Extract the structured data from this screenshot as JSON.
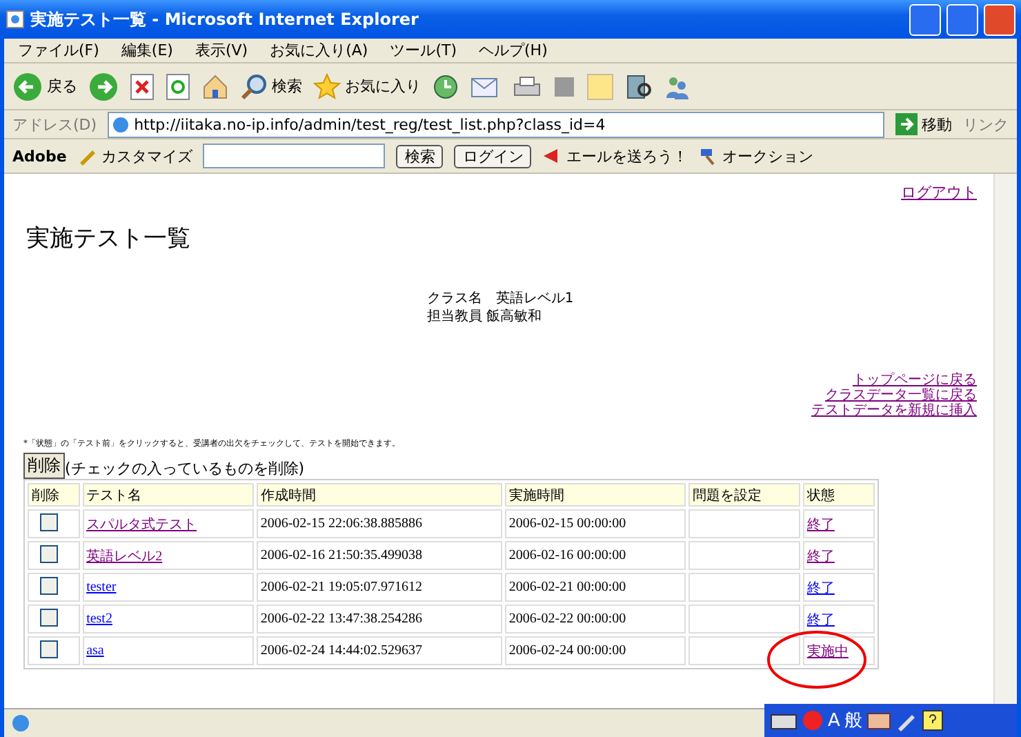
{
  "window": {
    "title": "実施テスト一覧 - Microsoft Internet Explorer"
  },
  "menu": [
    "ファイル(F)",
    "編集(E)",
    "表示(V)",
    "お気に入り(A)",
    "ツール(T)",
    "ヘルプ(H)"
  ],
  "toolbar": {
    "back": "戻る",
    "search": "検索",
    "favorites": "お気に入り"
  },
  "address": {
    "label": "アドレス(D)",
    "url": "http://iitaka.no-ip.info/admin/test_reg/test_list.php?class_id=4",
    "go": "移動",
    "links": "リンク"
  },
  "yahoo_bar": {
    "adobe": "Adobe",
    "customize": "カスタマイズ",
    "search": "検索",
    "login": "ログイン",
    "cheer": "エールを送ろう！",
    "auction": "オークション"
  },
  "page": {
    "logout": "ログアウト",
    "heading": "実施テスト一覧",
    "info": [
      "クラス名　英語レベル1",
      "担当教員 飯高敏和"
    ],
    "nav_links": [
      {
        "text": "トップページに戻る",
        "visited": true
      },
      {
        "text": "クラスデータ一覧に戻る",
        "visited": true
      },
      {
        "text": "テストデータを新規に挿入",
        "visited": true
      }
    ],
    "note": "*「状態」の「テスト前」をクリックすると、受講者の出欠をチェックして、テストを開始できます。",
    "delete_button": "削除",
    "delete_hint": "(チェックの入っているものを削除)",
    "table": {
      "columns": [
        "削除",
        "テスト名",
        "作成時間",
        "実施時間",
        "問題を設定",
        "状態"
      ],
      "rows": [
        {
          "checked": false,
          "name": {
            "text": "スパルタ式テスト",
            "visited": true
          },
          "created": "2006-02-15 22:06:38.885886",
          "held": "2006-02-15 00:00:00",
          "status": {
            "text": "終了",
            "visited": true
          }
        },
        {
          "checked": false,
          "name": {
            "text": "英語レベル2",
            "visited": true
          },
          "created": "2006-02-16 21:50:35.499038",
          "held": "2006-02-16 00:00:00",
          "status": {
            "text": "終了",
            "visited": true
          }
        },
        {
          "checked": false,
          "name": {
            "text": "tester",
            "visited": false
          },
          "created": "2006-02-21 19:05:07.971612",
          "held": "2006-02-21 00:00:00",
          "status": {
            "text": "終了",
            "visited": false
          }
        },
        {
          "checked": false,
          "name": {
            "text": "test2",
            "visited": false
          },
          "created": "2006-02-22 13:47:38.254286",
          "held": "2006-02-22 00:00:00",
          "status": {
            "text": "終了",
            "visited": false
          }
        },
        {
          "checked": false,
          "name": {
            "text": "asa",
            "visited": false
          },
          "created": "2006-02-24 14:44:02.529637",
          "held": "2006-02-24 00:00:00",
          "status": {
            "text": "実施中",
            "visited": true
          }
        }
      ]
    }
  },
  "ime_bar": {
    "mode": "A",
    "kana": "般"
  }
}
